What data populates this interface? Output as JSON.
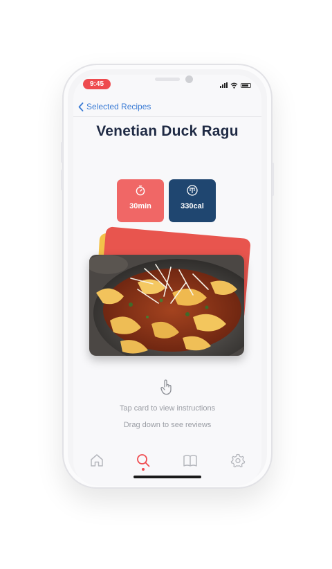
{
  "status_bar": {
    "time": "9:45"
  },
  "nav": {
    "back_label": "Selected Recipes"
  },
  "recipe": {
    "title": "Venetian Duck Ragu",
    "time": "30min",
    "calories": "330cal"
  },
  "hints": {
    "tap": "Tap card to view instructions",
    "drag": "Drag down to see reviews"
  },
  "tab_bar": {
    "items": [
      {
        "icon": "home-icon",
        "active": false
      },
      {
        "icon": "search-icon",
        "active": true
      },
      {
        "icon": "book-icon",
        "active": false
      },
      {
        "icon": "gear-icon",
        "active": false
      }
    ]
  },
  "colors": {
    "accent_red": "#f06766",
    "navy": "#1f4670",
    "link_blue": "#3a7bd5",
    "title": "#1f2a44",
    "card_back_red": "#e8554e",
    "card_back_yellow": "#f3c24a"
  }
}
